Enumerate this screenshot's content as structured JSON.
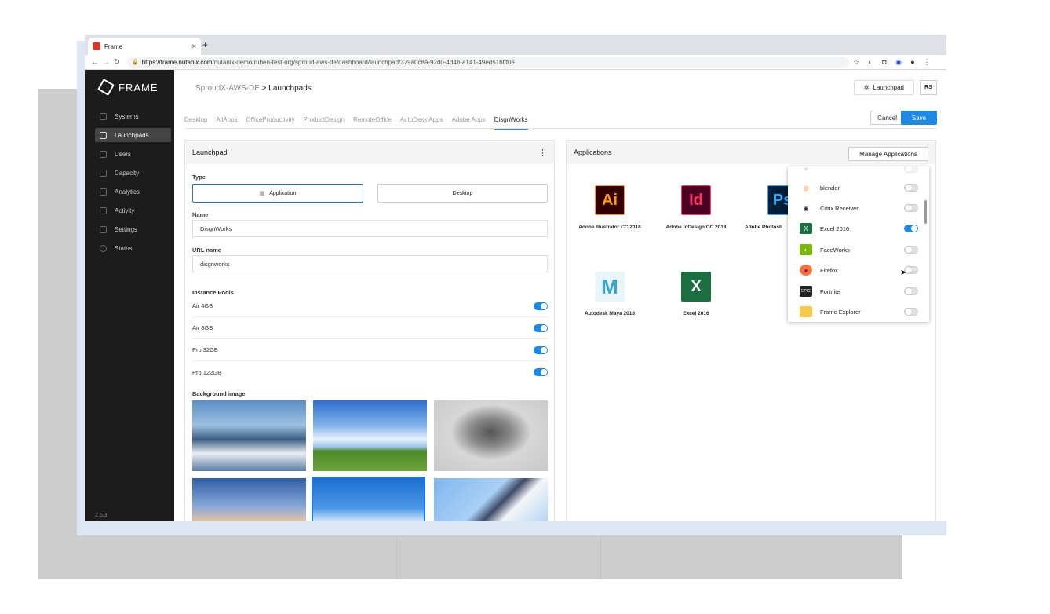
{
  "browser": {
    "tab_title": "Frame",
    "new_tab": "+",
    "close": "×",
    "url_host": "https://frame.nutanix.com",
    "url_path": "/nutanix-demo/ruben-test-org/sproud-aws-de/dashboard/launchpad/379a0c8a-92d0-4d4b-a141-49ed51bfff0e"
  },
  "sidebar": {
    "logo": "FRAME",
    "items": [
      {
        "label": "Systems"
      },
      {
        "label": "Launchpads"
      },
      {
        "label": "Users"
      },
      {
        "label": "Capacity"
      },
      {
        "label": "Analytics"
      },
      {
        "label": "Activity"
      },
      {
        "label": "Settings"
      },
      {
        "label": "Status"
      }
    ],
    "version": "2.6.3"
  },
  "header": {
    "crumb_parent": "SproudX-AWS-DE",
    "crumb_sep": ">",
    "crumb_current": "Launchpads",
    "launchpad_button": "Launchpad",
    "user_initials": "RS"
  },
  "tabs": [
    "Desktop",
    "AllApps",
    "OfficeProductivity",
    "ProductDesign",
    "RemoteOffice",
    "AutoDesk Apps",
    "Adobe Apps",
    "DisgnWorks"
  ],
  "actions": {
    "cancel": "Cancel",
    "save": "Save"
  },
  "launchpad": {
    "title": "Launchpad",
    "type_label": "Type",
    "type_application": "Application",
    "type_desktop": "Desktop",
    "name_label": "Name",
    "name_value": "DisgnWorks",
    "url_label": "URL name",
    "url_value": "disgnworks",
    "pools_label": "Instance Pools",
    "pools": [
      {
        "name": "Air 4GB",
        "enabled": true
      },
      {
        "name": "Air 8GB",
        "enabled": true
      },
      {
        "name": "Pro 32GB",
        "enabled": true
      },
      {
        "name": "Pro 122GB",
        "enabled": true
      }
    ],
    "bg_label": "Background image"
  },
  "applications": {
    "title": "Applications",
    "manage_button": "Manage Applications",
    "tiles": [
      {
        "name": "Adobe Illustrator CC 2018",
        "glyph": "Ai",
        "color": "#ff9a00",
        "bg": "#310000"
      },
      {
        "name": "Adobe InDesign CC 2018",
        "glyph": "Id",
        "color": "#ff3366",
        "bg": "#49021f"
      },
      {
        "name": "Adobe Photosh",
        "glyph": "Ps",
        "color": "#31a8ff",
        "bg": "#001e36"
      },
      {
        "name": "Autodesk Maya 2018",
        "glyph": "M",
        "color": "#37a5cc",
        "bg": "#e8f6fa"
      },
      {
        "name": "Excel 2016",
        "glyph": "X",
        "color": "#ffffff",
        "bg": "#1d6f42"
      }
    ],
    "dropdown": [
      {
        "name": "blender",
        "enabled": false,
        "icon": "blender-icon",
        "color": "#f5792a"
      },
      {
        "name": "Citrix Receiver",
        "enabled": false,
        "icon": "citrix-icon",
        "color": "#333333"
      },
      {
        "name": "Excel 2016",
        "enabled": true,
        "icon": "excel-icon",
        "color": "#1d6f42"
      },
      {
        "name": "FaceWorks",
        "enabled": false,
        "icon": "nvidia-icon",
        "color": "#76b900"
      },
      {
        "name": "Firefox",
        "enabled": false,
        "icon": "firefox-icon",
        "color": "#ff7139"
      },
      {
        "name": "Fortnite",
        "enabled": false,
        "icon": "epic-icon",
        "color": "#222222"
      },
      {
        "name": "Frame Explorer",
        "enabled": false,
        "icon": "folder-icon",
        "color": "#f7c94b"
      }
    ]
  }
}
